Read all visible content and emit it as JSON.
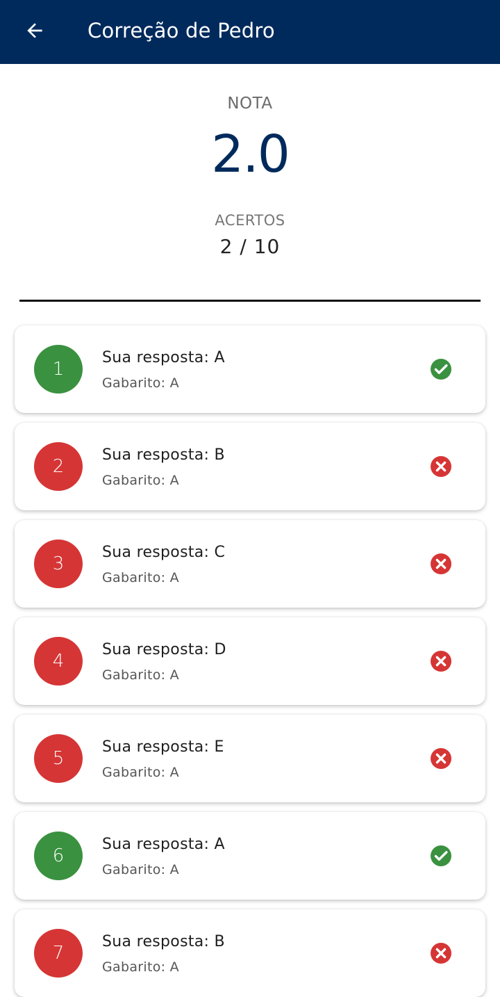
{
  "header": {
    "title": "Correção de Pedro",
    "back_icon": "arrow-left-icon"
  },
  "summary": {
    "nota_label": "NOTA",
    "nota_value": "2.0",
    "acertos_label": "ACERTOS",
    "acertos_value": "2 / 10"
  },
  "colors": {
    "primary": "#002a5c",
    "correct": "#3a9140",
    "wrong": "#d63535"
  },
  "questions": [
    {
      "number": "1",
      "answer": "Sua resposta: A",
      "key": "Gabarito: A",
      "status": "correct",
      "icon": "check-circle-icon"
    },
    {
      "number": "2",
      "answer": "Sua resposta: B",
      "key": "Gabarito: A",
      "status": "wrong",
      "icon": "x-circle-icon"
    },
    {
      "number": "3",
      "answer": "Sua resposta: C",
      "key": "Gabarito: A",
      "status": "wrong",
      "icon": "x-circle-icon"
    },
    {
      "number": "4",
      "answer": "Sua resposta: D",
      "key": "Gabarito: A",
      "status": "wrong",
      "icon": "x-circle-icon"
    },
    {
      "number": "5",
      "answer": "Sua resposta: E",
      "key": "Gabarito: A",
      "status": "wrong",
      "icon": "x-circle-icon"
    },
    {
      "number": "6",
      "answer": "Sua resposta: A",
      "key": "Gabarito: A",
      "status": "correct",
      "icon": "check-circle-icon"
    },
    {
      "number": "7",
      "answer": "Sua resposta: B",
      "key": "Gabarito: A",
      "status": "wrong",
      "icon": "x-circle-icon"
    }
  ]
}
